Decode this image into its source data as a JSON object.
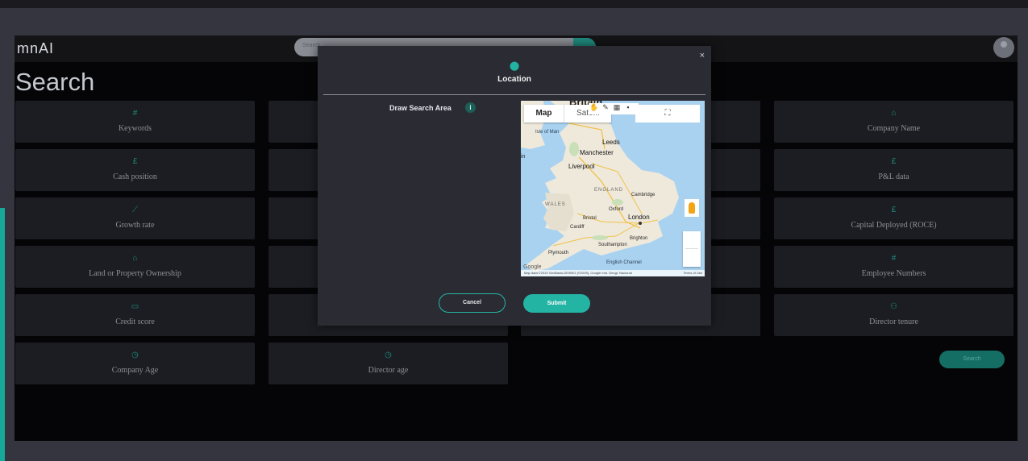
{
  "app": {
    "logo": "mnAI",
    "search_placeholder": "Search",
    "page_title": "Search"
  },
  "tiles": [
    {
      "label": "Keywords",
      "icon": "hash-icon",
      "glyph": "#"
    },
    {
      "label": "Company Name",
      "icon": "building-icon",
      "glyph": "⌂"
    },
    {
      "label": "Cash position",
      "icon": "pound-icon",
      "glyph": "£"
    },
    {
      "label": "P&L data",
      "icon": "pound-icon",
      "glyph": "£"
    },
    {
      "label": "Growth rate",
      "icon": "chart-icon",
      "glyph": "⟋"
    },
    {
      "label": "Capital Deployed (ROCE)",
      "icon": "pound-icon",
      "glyph": "£"
    },
    {
      "label": "Land or Property Ownership",
      "icon": "house-icon",
      "glyph": "⌂"
    },
    {
      "label": "Employee Numbers",
      "icon": "hash-icon",
      "glyph": "#"
    },
    {
      "label": "Credit score",
      "icon": "card-icon",
      "glyph": "▭"
    },
    {
      "label": "Director tenure",
      "icon": "people-icon",
      "glyph": "⚇"
    },
    {
      "label": "Company Age",
      "icon": "clock-icon",
      "glyph": "◷"
    },
    {
      "label": "Director age",
      "icon": "clock-icon",
      "glyph": "◷"
    }
  ],
  "background_search_button": "Search",
  "modal": {
    "close_glyph": "×",
    "pin_glyph": "⬤",
    "title": "Location",
    "draw_label": "Draw Search Area",
    "info_glyph": "i",
    "cancel_label": "Cancel",
    "submit_label": "Submit"
  },
  "map": {
    "tab_map": "Map",
    "tab_satellite": "Sate...",
    "fullscreen_glyph": "⛶",
    "top_cut_label": "Britain",
    "places": {
      "isle_of_man": "Isle of Man",
      "leeds": "Leeds",
      "manchester": "Manchester",
      "liverpool": "Liverpool",
      "england": "ENGLAND",
      "cambridge": "Cambridge",
      "wales": "WALES",
      "oxford": "Oxford",
      "bristol": "Bristol",
      "cardiff": "Cardiff",
      "london": "London",
      "brighton": "Brighton",
      "southampton": "Southampton",
      "plymouth": "Plymouth",
      "cut_left": "in",
      "channel": "English Channel"
    },
    "google_label": "Google",
    "attribution": "Map data ©2019 GeoBasis-DE/BKG (©2009), Google Inst. Geogr. Nacional",
    "terms": "Terms of Use"
  },
  "colors": {
    "accent": "#24b4a3",
    "tile_bg": "#1c1d22",
    "modal_bg": "#2b2c33"
  }
}
